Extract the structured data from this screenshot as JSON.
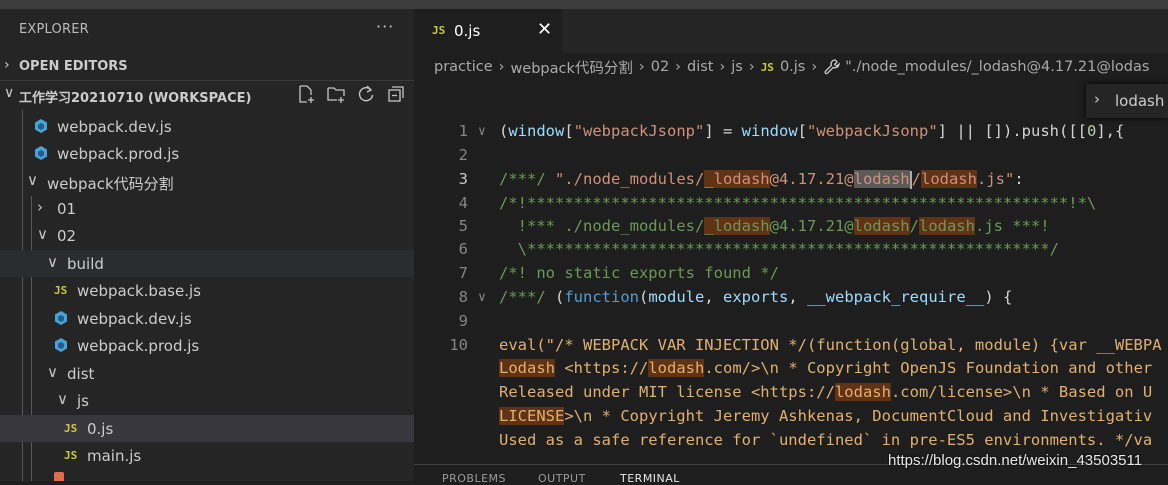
{
  "explorer": {
    "title": "EXPLORER",
    "more": "···",
    "open_editors": "OPEN EDITORS",
    "workspace": "工作学习20210710 (WORKSPACE)",
    "items": [
      {
        "label": "webpack.dev.js"
      },
      {
        "label": "webpack.prod.js"
      },
      {
        "label": "webpack代码分割"
      },
      {
        "label": "01"
      },
      {
        "label": "02"
      },
      {
        "label": "build"
      },
      {
        "label": "webpack.base.js"
      },
      {
        "label": "webpack.dev.js"
      },
      {
        "label": "webpack.prod.js"
      },
      {
        "label": "dist"
      },
      {
        "label": "js"
      },
      {
        "label": "0.js"
      },
      {
        "label": "main.js"
      }
    ],
    "js_badge": "JS"
  },
  "editor": {
    "tab": {
      "label": "0.js",
      "badge": "JS",
      "close": "✕"
    },
    "breadcrumb": [
      "practice",
      "webpack代码分割",
      "02",
      "dist",
      "js",
      "0.js",
      "\"./node_modules/_lodash@4.17.21@lodas"
    ],
    "sticky": "lodash",
    "line_numbers": [
      "1",
      "2",
      "3",
      "4",
      "5",
      "6",
      "7",
      "8",
      "9",
      "10"
    ],
    "code": {
      "l1_a": "(",
      "l1_b": "window",
      "l1_c": "[",
      "l1_d": "\"webpackJsonp\"",
      "l1_e": "] = ",
      "l1_f": "window",
      "l1_g": "[",
      "l1_h": "\"webpackJsonp\"",
      "l1_i": "] || []).push([[",
      "l1_j": "0",
      "l1_k": "],{",
      "l3_a": "/***/ ",
      "l3_b": "\"./node_modules/",
      "l3_c": "_lodash",
      "l3_d": "@4.17.21@",
      "l3_e": "lodash",
      "l3_f": "/",
      "l3_g": "lodash",
      "l3_h": ".js\"",
      "l3_i": ":",
      "l4": "/*!**********************************************************!*\\",
      "l5_a": "  !*** ./node_modules/",
      "l5_b": "_lodash",
      "l5_c": "@4.17.21@",
      "l5_d": "lodash",
      "l5_e": "/",
      "l5_f": "lodash",
      "l5_g": ".js ***!",
      "l6": "  \\********************************************************/",
      "l7": "/*! no static exports found */",
      "l8_a": "/***/ ",
      "l8_b": "(",
      "l8_c": "function",
      "l8_d": "(",
      "l8_e": "module",
      "l8_f": ", ",
      "l8_g": "exports",
      "l8_h": ", ",
      "l8_i": "__webpack_require__",
      "l8_j": ") {",
      "l10": "eval(\"/* WEBPACK VAR INJECTION */(function(global, module) {var __WEBPA",
      "w1_a": "Lodash",
      "w1_b": " <https://",
      "w1_c": "lodash",
      "w1_d": ".com/>\\n * Copyright OpenJS Foundation and other",
      "w2_a": "Released under MIT license <https://",
      "w2_b": "lodash",
      "w2_c": ".com/license>\\n * Based on U",
      "w3_a": "LICENSE",
      "w3_b": ">\\n * Copyright Jeremy Ashkenas, DocumentCloud and Investigativ",
      "w4": "Used as a safe reference for `undefined` in pre-ES5 environments. */va"
    },
    "panel_tabs": [
      "PROBLEMS",
      "OUTPUT",
      "TERMINAL"
    ]
  },
  "watermark": "https://blog.csdn.net/weixin_43503511"
}
